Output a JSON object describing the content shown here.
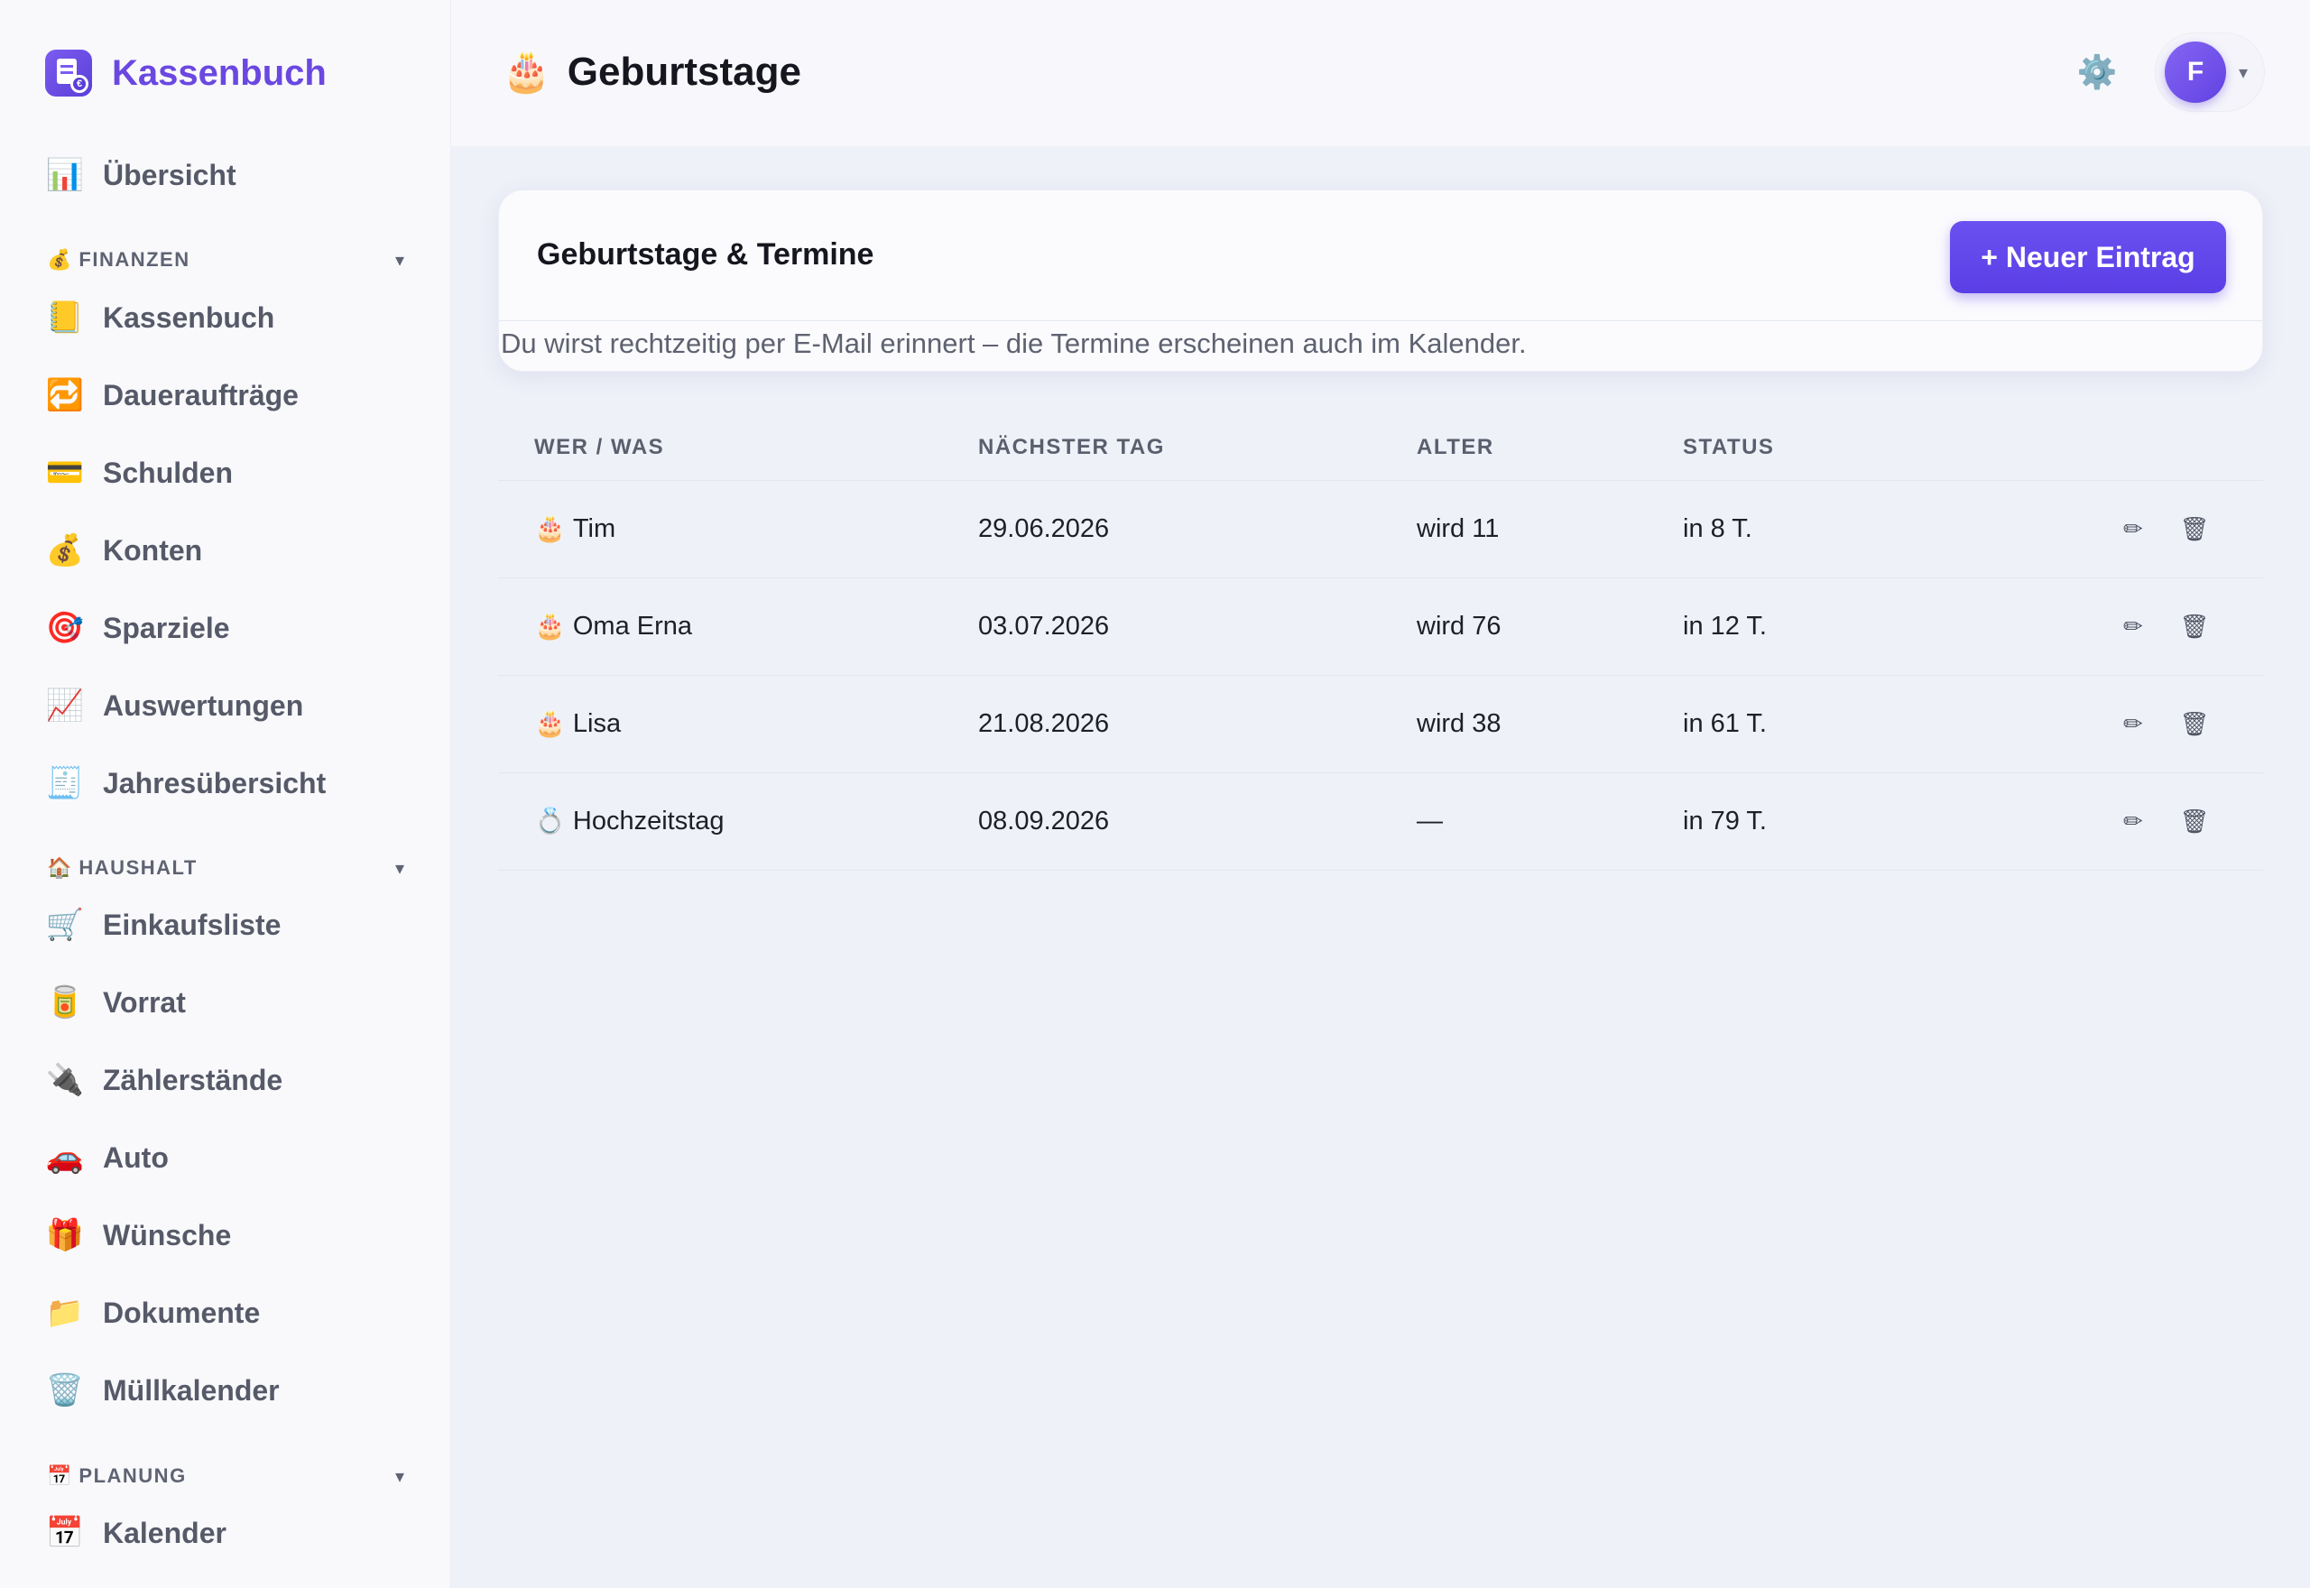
{
  "app": {
    "title": "Kassenbuch"
  },
  "sidebar": {
    "overview": {
      "icon": "📊",
      "label": "Übersicht"
    },
    "sections": [
      {
        "icon": "💰",
        "label": "FINANZEN",
        "caret": "▾",
        "items": [
          {
            "icon": "📒",
            "label": "Kassenbuch"
          },
          {
            "icon": "🔁",
            "label": "Daueraufträge"
          },
          {
            "icon": "💳",
            "label": "Schulden"
          },
          {
            "icon": "💰",
            "label": "Konten"
          },
          {
            "icon": "🎯",
            "label": "Sparziele"
          },
          {
            "icon": "📈",
            "label": "Auswertungen"
          },
          {
            "icon": "🧾",
            "label": "Jahresübersicht"
          }
        ]
      },
      {
        "icon": "🏠",
        "label": "HAUSHALT",
        "caret": "▾",
        "items": [
          {
            "icon": "🛒",
            "label": "Einkaufsliste"
          },
          {
            "icon": "🥫",
            "label": "Vorrat"
          },
          {
            "icon": "🔌",
            "label": "Zählerstände"
          },
          {
            "icon": "🚗",
            "label": "Auto"
          },
          {
            "icon": "🎁",
            "label": "Wünsche"
          },
          {
            "icon": "📁",
            "label": "Dokumente"
          },
          {
            "icon": "🗑️",
            "label": "Müllkalender"
          }
        ]
      },
      {
        "icon": "📅",
        "label": "PLANUNG",
        "caret": "▾",
        "items": [
          {
            "icon": "📅",
            "label": "Kalender"
          }
        ]
      }
    ]
  },
  "header": {
    "icon": "🎂",
    "title": "Geburtstage",
    "settings_icon": "⚙️",
    "user_initial": "F",
    "user_caret": "▾"
  },
  "card": {
    "title": "Geburtstage & Termine",
    "new_button": "+ Neuer Eintrag",
    "description": "Du wirst rechtzeitig per E-Mail erinnert – die Termine erscheinen auch im Kalender."
  },
  "table": {
    "columns": [
      "WER / WAS",
      "NÄCHSTER TAG",
      "ALTER",
      "STATUS"
    ],
    "edit_icon": "✏",
    "delete_icon": "🗑",
    "rows": [
      {
        "icon": "🎂",
        "name": "Tim",
        "date": "29.06.2026",
        "age": "wird 11",
        "status": "in 8 T."
      },
      {
        "icon": "🎂",
        "name": "Oma Erna",
        "date": "03.07.2026",
        "age": "wird 76",
        "status": "in 12 T."
      },
      {
        "icon": "🎂",
        "name": "Lisa",
        "date": "21.08.2026",
        "age": "wird 38",
        "status": "in 61 T."
      },
      {
        "icon": "💍",
        "name": "Hochzeitstag",
        "date": "08.09.2026",
        "age": "—",
        "status": "in 79 T."
      }
    ]
  },
  "colors": {
    "accent": "#6a48e0",
    "button": "#5b3fe6",
    "background": "#eef1f8"
  }
}
